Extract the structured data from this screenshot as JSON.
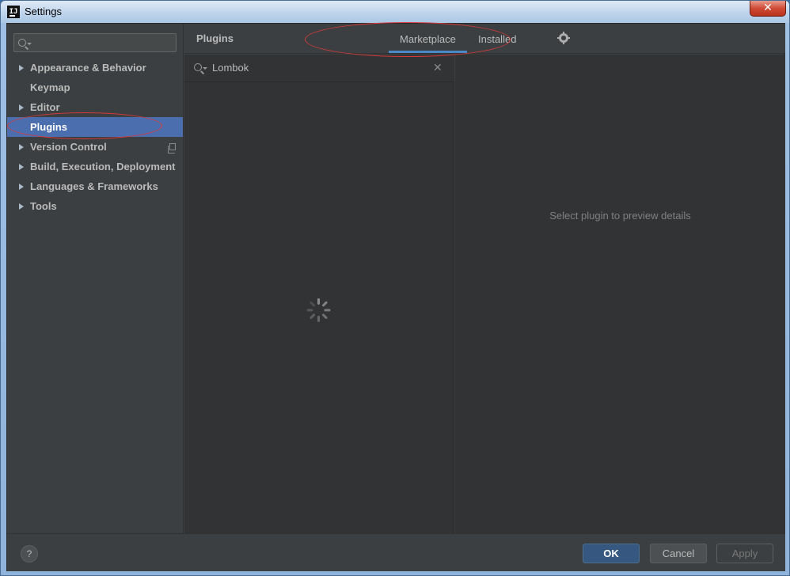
{
  "window": {
    "title": "Settings",
    "close_glyph": "✕",
    "app_icon": "IJ"
  },
  "sidebar": {
    "search_placeholder": "",
    "items": [
      {
        "label": "Appearance & Behavior",
        "expandable": true
      },
      {
        "label": "Keymap",
        "expandable": false
      },
      {
        "label": "Editor",
        "expandable": true
      },
      {
        "label": "Plugins",
        "expandable": false,
        "selected": true
      },
      {
        "label": "Version Control",
        "expandable": true
      },
      {
        "label": "Build, Execution, Deployment",
        "expandable": true
      },
      {
        "label": "Languages & Frameworks",
        "expandable": true
      },
      {
        "label": "Tools",
        "expandable": true
      }
    ]
  },
  "header": {
    "title": "Plugins",
    "tabs": [
      {
        "label": "Marketplace",
        "active": true
      },
      {
        "label": "Installed",
        "active": false
      }
    ],
    "gear_icon": "gear-icon"
  },
  "plugins": {
    "search_value": "Lombok",
    "clear_glyph": "✕",
    "loading": true,
    "details_hint": "Select plugin to preview details"
  },
  "footer": {
    "help_label": "?",
    "ok_label": "OK",
    "cancel_label": "Cancel",
    "apply_label": "Apply"
  },
  "colors": {
    "selection": "#4b6eaf",
    "tab_underline": "#4a88c7",
    "annotation": "#d63a3a"
  }
}
